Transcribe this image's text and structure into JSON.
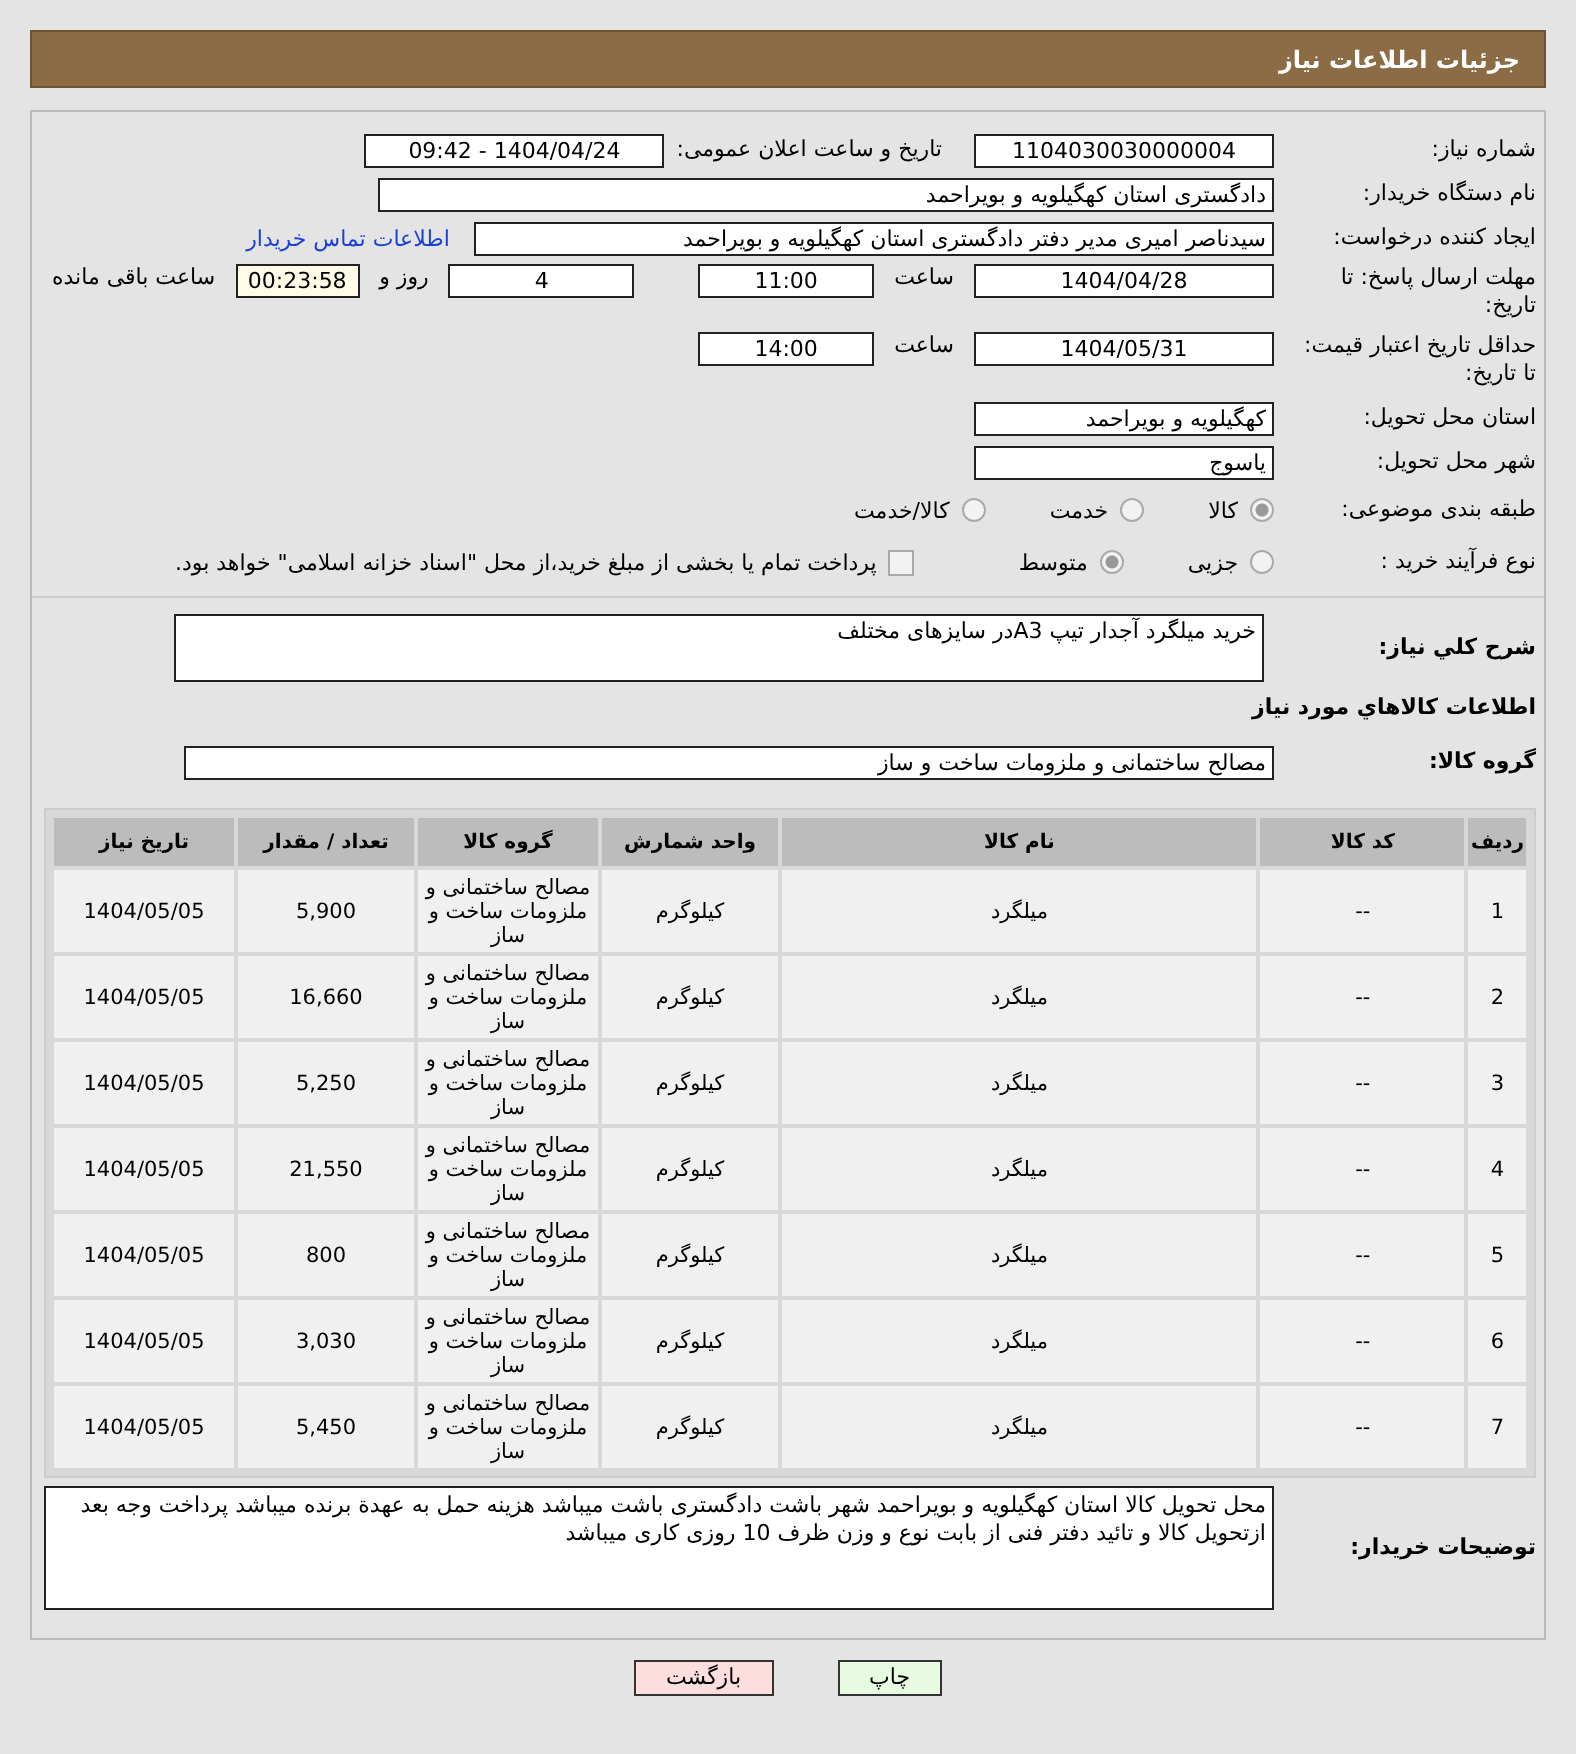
{
  "header": {
    "title": "جزئیات اطلاعات نیاز"
  },
  "need_number": {
    "label": "شماره نیاز:",
    "value": "1104030030000004"
  },
  "announce": {
    "label": "تاریخ و ساعت اعلان عمومی:",
    "value": "1404/04/24 - 09:42"
  },
  "buyer_org": {
    "label": "نام دستگاه خریدار:",
    "value": "دادگستری استان کهگیلویه و بویراحمد"
  },
  "requester": {
    "label": "ایجاد کننده درخواست:",
    "value": "سیدناصر امیری مدیر دفتر دادگستری استان کهگیلویه و بویراحمد",
    "link": "اطلاعات تماس خریدار"
  },
  "reply_deadline": {
    "label": "مهلت ارسال پاسخ: تا تاریخ:",
    "date": "1404/04/28",
    "time_label": "ساعت",
    "time": "11:00",
    "days": "4",
    "days_label": "روز و",
    "remaining": "00:23:58",
    "remaining_label": "ساعت باقی مانده"
  },
  "price_validity": {
    "label": "حداقل تاریخ اعتبار قیمت: تا تاریخ:",
    "date": "1404/05/31",
    "time_label": "ساعت",
    "time": "14:00"
  },
  "delivery_province": {
    "label": "استان محل تحویل:",
    "value": "کهگیلویه و بویراحمد"
  },
  "delivery_city": {
    "label": "شهر محل تحویل:",
    "value": "یاسوج"
  },
  "category": {
    "label": "طبقه بندی موضوعی:",
    "options": [
      {
        "label": "کالا",
        "selected": true
      },
      {
        "label": "خدمت",
        "selected": false
      },
      {
        "label": "کالا/خدمت",
        "selected": false
      }
    ]
  },
  "process": {
    "label": "نوع فرآیند خرید :",
    "options": [
      {
        "label": "جزیی",
        "selected": false
      },
      {
        "label": "متوسط",
        "selected": true
      }
    ],
    "payment": {
      "label": "پرداخت تمام یا بخشی از مبلغ خرید،از محل \"اسناد خزانه اسلامی\" خواهد بود.",
      "checked": false
    }
  },
  "description": {
    "label": "شرح کلي نياز:",
    "value": "خرید میلگرد آجدار تیپ A3در سایزهای مختلف"
  },
  "goods_heading": "اطلاعات کالاهاي مورد نياز",
  "goods_group": {
    "label": "گروه کالا:",
    "value": "مصالح ساختمانی و ملزومات ساخت و ساز"
  },
  "table": {
    "columns": [
      "ردیف",
      "کد کالا",
      "نام کالا",
      "واحد شمارش",
      "گروه کالا",
      "تعداد / مقدار",
      "تاریخ نیاز"
    ],
    "rows": [
      [
        "1",
        "--",
        "میلگرد",
        "کیلوگرم",
        "مصالح ساختمانی و ملزومات ساخت و ساز",
        "5,900",
        "1404/05/05"
      ],
      [
        "2",
        "--",
        "میلگرد",
        "کیلوگرم",
        "مصالح ساختمانی و ملزومات ساخت و ساز",
        "16,660",
        "1404/05/05"
      ],
      [
        "3",
        "--",
        "میلگرد",
        "کیلوگرم",
        "مصالح ساختمانی و ملزومات ساخت و ساز",
        "5,250",
        "1404/05/05"
      ],
      [
        "4",
        "--",
        "میلگرد",
        "کیلوگرم",
        "مصالح ساختمانی و ملزومات ساخت و ساز",
        "21,550",
        "1404/05/05"
      ],
      [
        "5",
        "--",
        "میلگرد",
        "کیلوگرم",
        "مصالح ساختمانی و ملزومات ساخت و ساز",
        "800",
        "1404/05/05"
      ],
      [
        "6",
        "--",
        "میلگرد",
        "کیلوگرم",
        "مصالح ساختمانی و ملزومات ساخت و ساز",
        "3,030",
        "1404/05/05"
      ],
      [
        "7",
        "--",
        "میلگرد",
        "کیلوگرم",
        "مصالح ساختمانی و ملزومات ساخت و ساز",
        "5,450",
        "1404/05/05"
      ]
    ]
  },
  "buyer_notes": {
    "label": "توضیحات خریدار:",
    "value": "محل تحویل کالا استان کهگیلویه و بویراحمد شهر باشت دادگستری باشت میباشد هزینه حمل به عهدة برنده میباشد پرداخت وجه بعد ازتحویل کالا و تائید دفتر فنی از بابت نوع و وزن ظرف 10 روزی کاری میباشد"
  },
  "buttons": [
    {
      "label": "چاپ",
      "kind": "print"
    },
    {
      "label": "بازگشت",
      "kind": "back"
    }
  ]
}
